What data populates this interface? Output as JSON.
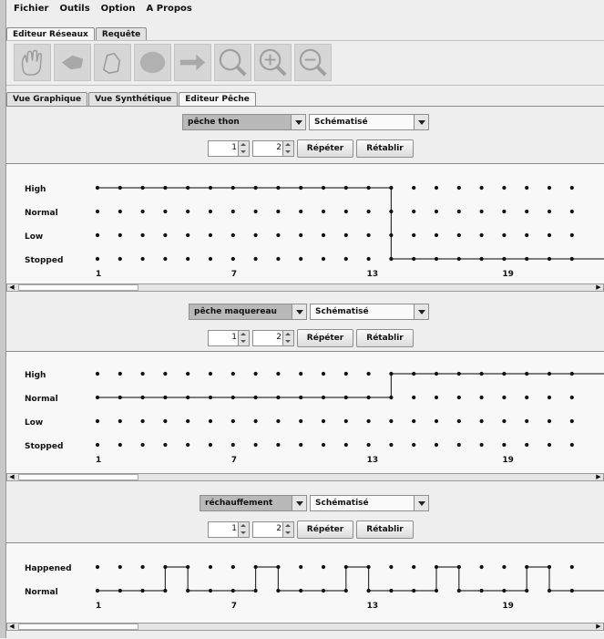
{
  "menu": [
    "Fichier",
    "Outils",
    "Option",
    "A Propos"
  ],
  "main_tabs": [
    "Editeur Réseaux",
    "Requête"
  ],
  "toolbar": {
    "tools": [
      "hand-tool",
      "move-tool",
      "pan-tool",
      "zoom-fit-tool",
      "arrow-tool",
      "zoom-tool",
      "zoom-in-tool",
      "zoom-out-tool"
    ]
  },
  "view_tabs": [
    "Vue Graphique",
    "Vue Synthétique",
    "Editeur Pêche"
  ],
  "colors": {
    "background": "#eeeeee",
    "line": "#333333",
    "dot": "#111111"
  },
  "panels": [
    {
      "variable": "pêche thon",
      "mode": "Schématisé",
      "spin1": "1",
      "spin2": "2",
      "repeat_label": "Répéter",
      "reset_label": "Rétablir",
      "chart_data": {
        "type": "line",
        "levels": [
          "High",
          "Normal",
          "Low",
          "Stopped"
        ],
        "x_ticks": [
          "1",
          "7",
          "13",
          "19"
        ],
        "values": [
          "High",
          "High",
          "High",
          "High",
          "High",
          "High",
          "High",
          "High",
          "High",
          "High",
          "High",
          "High",
          "High",
          "Stopped",
          "Stopped",
          "Stopped",
          "Stopped",
          "Stopped",
          "Stopped",
          "Stopped",
          "Stopped",
          "Stopped"
        ]
      }
    },
    {
      "variable": "pêche maquereau",
      "mode": "Schématisé",
      "spin1": "1",
      "spin2": "2",
      "repeat_label": "Répéter",
      "reset_label": "Rétablir",
      "chart_data": {
        "type": "line",
        "levels": [
          "High",
          "Normal",
          "Low",
          "Stopped"
        ],
        "x_ticks": [
          "1",
          "7",
          "13",
          "19"
        ],
        "values": [
          "Normal",
          "Normal",
          "Normal",
          "Normal",
          "Normal",
          "Normal",
          "Normal",
          "Normal",
          "Normal",
          "Normal",
          "Normal",
          "Normal",
          "Normal",
          "High",
          "High",
          "High",
          "High",
          "High",
          "High",
          "High",
          "High",
          "High"
        ]
      }
    },
    {
      "variable": "réchauffement",
      "mode": "Schématisé",
      "spin1": "1",
      "spin2": "2",
      "repeat_label": "Répéter",
      "reset_label": "Rétablir",
      "chart_data": {
        "type": "line",
        "levels": [
          "Happened",
          "Normal"
        ],
        "x_ticks": [
          "1",
          "7",
          "13",
          "19"
        ],
        "values": [
          "Normal",
          "Normal",
          "Normal",
          "Happened",
          "Normal",
          "Normal",
          "Normal",
          "Happened",
          "Normal",
          "Normal",
          "Normal",
          "Happened",
          "Normal",
          "Normal",
          "Normal",
          "Happened",
          "Normal",
          "Normal",
          "Normal",
          "Happened",
          "Normal",
          "Normal"
        ]
      }
    }
  ]
}
